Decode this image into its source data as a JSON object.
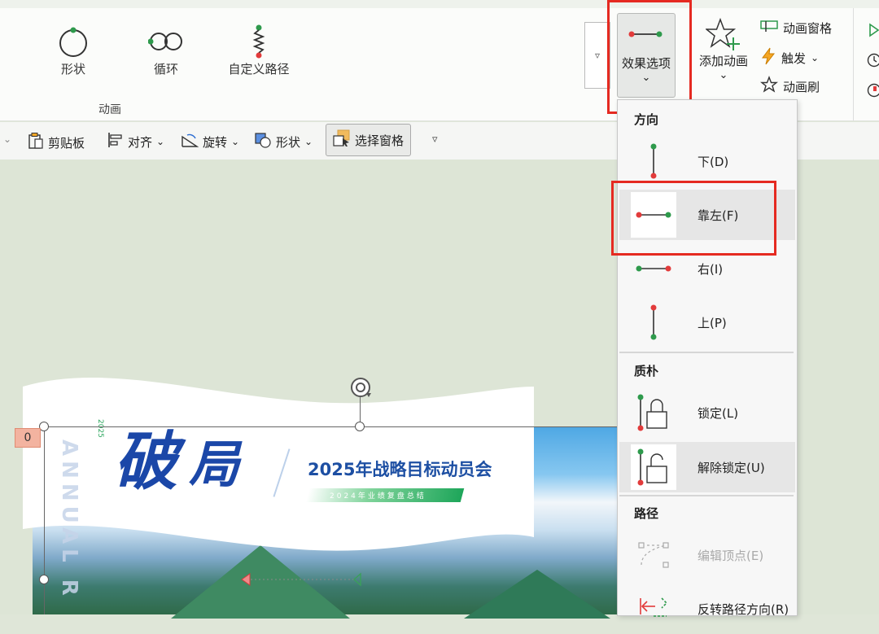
{
  "ribbon": {
    "gallery": [
      {
        "label": "形状",
        "icon": "shape-circle-icon"
      },
      {
        "label": "循环",
        "icon": "loop-icon"
      },
      {
        "label": "自定义路径",
        "icon": "custom-path-icon"
      }
    ],
    "group_label": "动画",
    "scroll_button": "▿",
    "effect_options": {
      "label": "效果选项",
      "chevron": "⌄"
    },
    "add_animation": {
      "label": "添加动画",
      "chevron": "⌄"
    },
    "animation_pane": "动画窗格",
    "trigger": "触发",
    "trigger_chevron": "⌄",
    "animation_painter": "动画刷"
  },
  "toolbar2": {
    "left_chevron": "⌄",
    "clipboard": "剪贴板",
    "align": "对齐",
    "rotate": "旋转",
    "shape": "形状",
    "selection_pane": "选择窗格",
    "more": "▿",
    "chevron": "⌄"
  },
  "slide": {
    "title": "2025年战略目标动员会",
    "subtitle": "2024年业绩复盘总结",
    "script_char1": "破",
    "script_char2": "局",
    "year_vertical": "2025",
    "annual_vertical": "ANNUAL R",
    "animation_badge": "0"
  },
  "dropdown": {
    "sections": [
      {
        "header": "方向",
        "items": [
          {
            "label": "下(D)",
            "icon": "path-down-icon"
          },
          {
            "label": "靠左(F)",
            "icon": "path-left-icon"
          },
          {
            "label": "右(I)",
            "icon": "path-right-icon"
          },
          {
            "label": "上(P)",
            "icon": "path-up-icon"
          }
        ]
      },
      {
        "header": "质朴",
        "items": [
          {
            "label": "锁定(L)",
            "icon": "lock-icon"
          },
          {
            "label": "解除锁定(U)",
            "icon": "unlock-icon"
          }
        ]
      },
      {
        "header": "路径",
        "items": [
          {
            "label": "编辑顶点(E)",
            "icon": "edit-points-icon"
          },
          {
            "label": "反转路径方向(R)",
            "icon": "reverse-path-icon"
          }
        ]
      }
    ]
  },
  "colors": {
    "highlight": "#e52a21",
    "path_start": "#2e9a4c",
    "path_end": "#e23b3b",
    "title_blue": "#1d4fa3"
  }
}
